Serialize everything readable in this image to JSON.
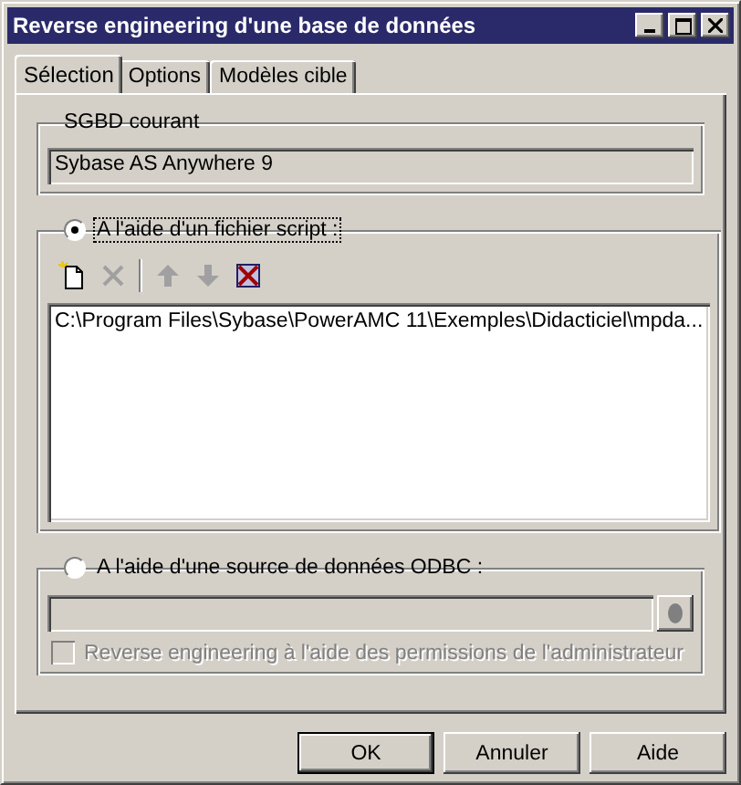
{
  "window": {
    "title": "Reverse engineering d'une base de données"
  },
  "tabs": [
    {
      "label": "Sélection",
      "selected": true
    },
    {
      "label": "Options",
      "selected": false
    },
    {
      "label": "Modèles cible",
      "selected": false
    }
  ],
  "dbms_group": {
    "title": "SGBD courant",
    "value": "Sybase AS Anywhere 9"
  },
  "script_group": {
    "label": "A l'aide d'un fichier script :",
    "selected": true,
    "toolbar": [
      {
        "kind": "new",
        "disabled": false
      },
      {
        "kind": "delete",
        "disabled": true
      },
      {
        "kind": "separator"
      },
      {
        "kind": "up",
        "disabled": true
      },
      {
        "kind": "down",
        "disabled": true
      },
      {
        "kind": "clear",
        "disabled": false
      }
    ],
    "files": [
      "C:\\Program Files\\Sybase\\PowerAMC 11\\Exemples\\Didacticiel\\mpda..."
    ]
  },
  "odbc_group": {
    "label": "A l'aide d'une source de données ODBC :",
    "selected": false,
    "disabled": true,
    "checkbox": {
      "label": "Reverse engineering à l'aide des permissions de l'administrateur",
      "checked": false
    }
  },
  "buttons": [
    {
      "label": "OK",
      "default": true
    },
    {
      "label": "Annuler",
      "default": false
    },
    {
      "label": "Aide",
      "default": false
    }
  ]
}
